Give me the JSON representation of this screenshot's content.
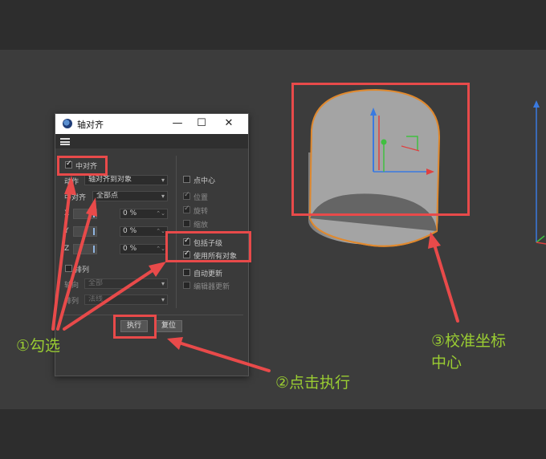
{
  "window": {
    "title": "轴对齐",
    "minimize_icon": "minimize-icon",
    "maximize_icon": "maximize-icon",
    "close_icon": "close-icon"
  },
  "menu": {
    "icon": "hamburger-menu-icon"
  },
  "options": {
    "center_align": {
      "label": "中对齐",
      "checked": true
    },
    "action": {
      "label": "动作",
      "value": "轴对齐到对象"
    },
    "center_mode": {
      "label": "中对齐",
      "value": "全部点"
    },
    "axes": [
      {
        "label": "X",
        "value": "0 %"
      },
      {
        "label": "Y",
        "value": "0 %"
      },
      {
        "label": "Z",
        "value": "0 %"
      }
    ],
    "arrange": {
      "label": "排列",
      "checked": false
    },
    "axis_dir": {
      "label": "轴向",
      "value": "全部"
    },
    "sort": {
      "label": "排列",
      "value": "法线"
    }
  },
  "right_options": {
    "point_center": {
      "label": "点中心",
      "checked": false
    },
    "position": {
      "label": "位置",
      "checked": true
    },
    "rotation": {
      "label": "旋转",
      "checked": true
    },
    "scale": {
      "label": "缩放",
      "checked": false
    },
    "include_children": {
      "label": "包括子级",
      "checked": true
    },
    "use_all_objects": {
      "label": "使用所有对象",
      "checked": true
    },
    "auto_update": {
      "label": "自动更新",
      "checked": false
    },
    "editor_update": {
      "label": "编辑器更新",
      "checked": false
    }
  },
  "buttons": {
    "execute": "执行",
    "reset": "复位"
  },
  "annotations": {
    "step1": "①勾选",
    "step2": "②点击执行",
    "step3_line1": "③校准坐标",
    "step3_line2": "中心"
  },
  "colors": {
    "highlight": "#e84a4a",
    "callout_text": "#9acd32",
    "cylinder_outline": "#e0892e",
    "axis_x": "#e04040",
    "axis_y": "#40c040",
    "axis_z": "#3a7ae0"
  }
}
